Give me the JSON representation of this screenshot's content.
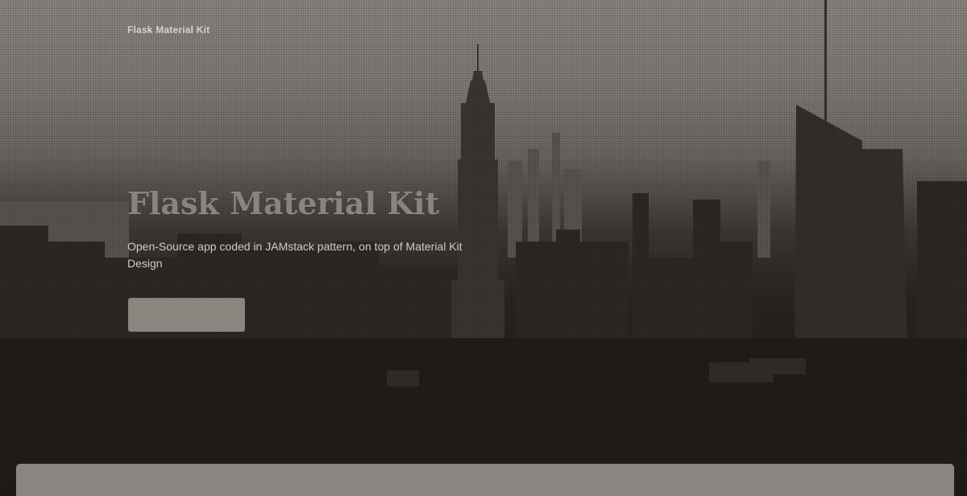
{
  "navbar": {
    "brand": "Flask Material Kit"
  },
  "hero": {
    "title": "Flask Material Kit",
    "subtitle": "Open-Source app coded in JAMstack pattern, on top of Material Kit Design"
  },
  "colors": {
    "sky": "#8b8580",
    "skyline_dark": "#1e1a17",
    "button": "#8b8580",
    "card": "#8a8580"
  }
}
